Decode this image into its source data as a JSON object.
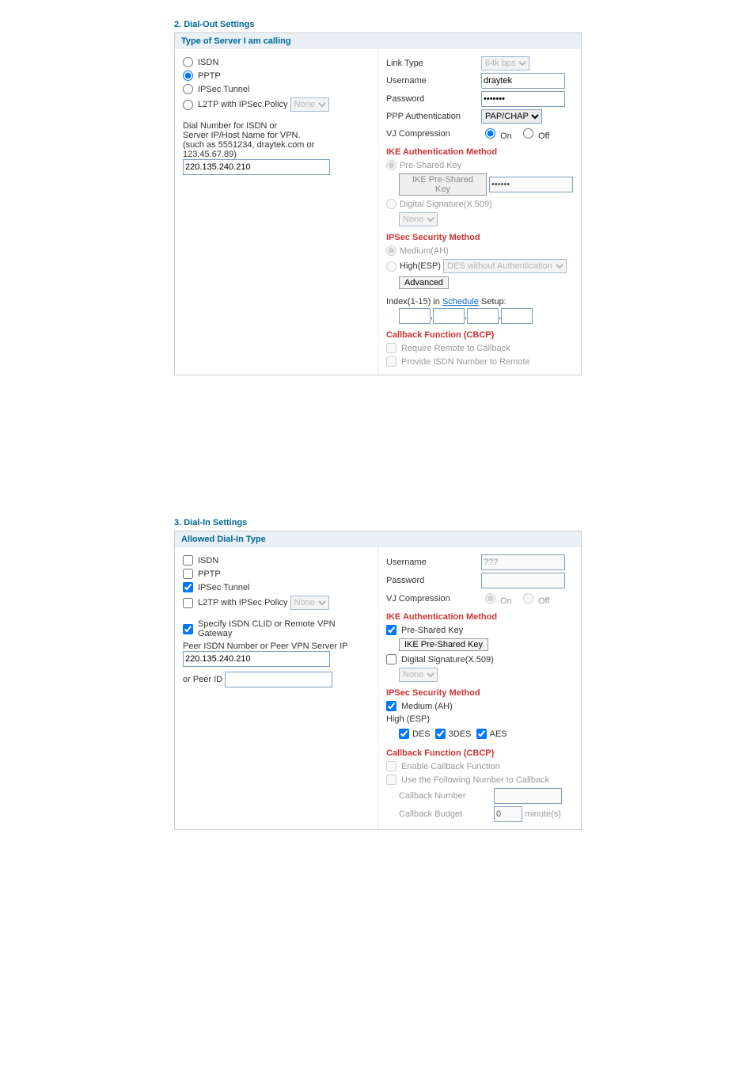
{
  "dialOut": {
    "sectionTitle": "2. Dial-Out Settings",
    "leftHeader": "Type of Server I am calling",
    "serverTypes": {
      "isdn": "ISDN",
      "pptp": "PPTP",
      "ipsec": "IPSec Tunnel",
      "l2tp": "L2TP with IPSec Policy",
      "l2tpPolicy": "None"
    },
    "dialLabel1": "Dial Number for ISDN or",
    "dialLabel2": "Server IP/Host Name for VPN.",
    "dialLabel3": "(such as 5551234, draytek.com or 123.45.67.89)",
    "dialValue": "220.135.240.210",
    "link": {
      "label": "Link Type",
      "value": "64k bps"
    },
    "username": {
      "label": "Username",
      "value": "draytek"
    },
    "password": {
      "label": "Password",
      "value": "•••••••"
    },
    "pppAuth": {
      "label": "PPP Authentication",
      "value": "PAP/CHAP"
    },
    "vj": {
      "label": "VJ Compression",
      "on": "On",
      "off": "Off"
    },
    "ike": {
      "heading": "IKE Authentication Method",
      "psk": "Pre-Shared Key",
      "pskBtn": "IKE Pre-Shared Key",
      "pskValue": "••••••",
      "digSig": "Digital Signature(X.509)",
      "digSigSel": "None"
    },
    "ipsecSec": {
      "heading": "IPSec Security Method",
      "medium": "Medium(AH)",
      "highLabel": "High(ESP)",
      "highSel": "DES without Authentication",
      "advanced": "Advanced"
    },
    "schedule": {
      "prefix": "Index(1-15) in ",
      "link": "Schedule",
      "suffix": " Setup:"
    },
    "cbcp": {
      "heading": "Callback Function (CBCP)",
      "require": "Require Remote to Callback",
      "provide": "Provide ISDN Number to Remote"
    }
  },
  "dialIn": {
    "sectionTitle": "3. Dial-In Settings",
    "leftHeader": "Allowed Dial-In Type",
    "types": {
      "isdn": "ISDN",
      "pptp": "PPTP",
      "ipsec": "IPSec Tunnel",
      "l2tp": "L2TP with IPSec Policy",
      "l2tpPolicy": "None"
    },
    "specify": "Specify ISDN CLID or Remote VPN Gateway",
    "peerLabel": "Peer ISDN Number or Peer VPN Server IP",
    "peerValue": "220.135.240.210",
    "orPeer": "or Peer ID",
    "username": {
      "label": "Username",
      "value": "???"
    },
    "password": {
      "label": "Password",
      "value": ""
    },
    "vj": {
      "label": "VJ Compression",
      "on": "On",
      "off": "Off"
    },
    "ike": {
      "heading": "IKE Authentication Method",
      "psk": "Pre-Shared Key",
      "pskBtn": "IKE Pre-Shared Key",
      "digSig": "Digital Signature(X.509)",
      "digSigSel": "None"
    },
    "ipsecSec": {
      "heading": "IPSec Security Method",
      "medium": "Medium (AH)",
      "high": "High (ESP)",
      "des": "DES",
      "tdes": "3DES",
      "aes": "AES"
    },
    "cbcp": {
      "heading": "Callback Function (CBCP)",
      "enable": "Enable Callback Function",
      "useNum": "Use the Following Number to Callback",
      "cbNum": "Callback Number",
      "cbBudget": "Callback Budget",
      "budgetVal": "0",
      "unit": "minute(s)"
    }
  }
}
